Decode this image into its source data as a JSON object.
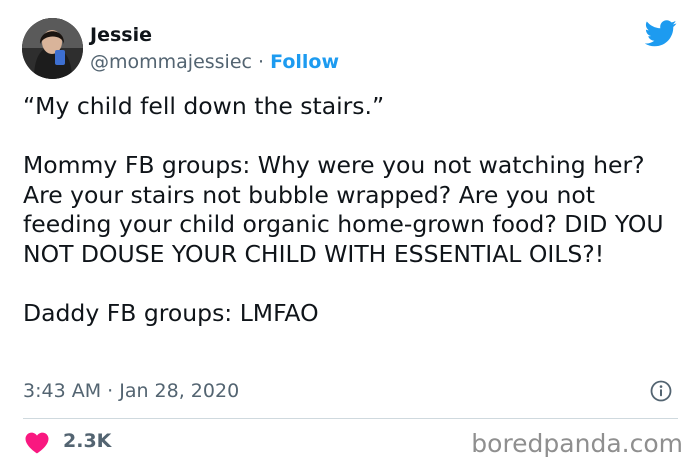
{
  "author": {
    "display_name": "Jessie",
    "handle": "@mommajessiec",
    "separator": "·",
    "follow_label": "Follow"
  },
  "tweet": {
    "paragraphs": [
      "“My child fell down the stairs.”",
      "Mommy FB groups: Why were you not watching her? Are your stairs not bubble wrapped? Are you not feeding your child organic home-grown food? DID YOU NOT DOUSE YOUR CHILD WITH ESSENTIAL OILS?!",
      "Daddy FB groups: LMFAO"
    ],
    "timestamp": "3:43 AM · Jan 28, 2020"
  },
  "engagement": {
    "like_count": "2.3K"
  },
  "icons": {
    "brand": "twitter-bird-icon",
    "info": "info-icon",
    "like": "heart-icon"
  },
  "colors": {
    "accent": "#1d9bf0",
    "like": "#f91880",
    "secondary_text": "#536471"
  },
  "watermark": "boredpanda.com"
}
